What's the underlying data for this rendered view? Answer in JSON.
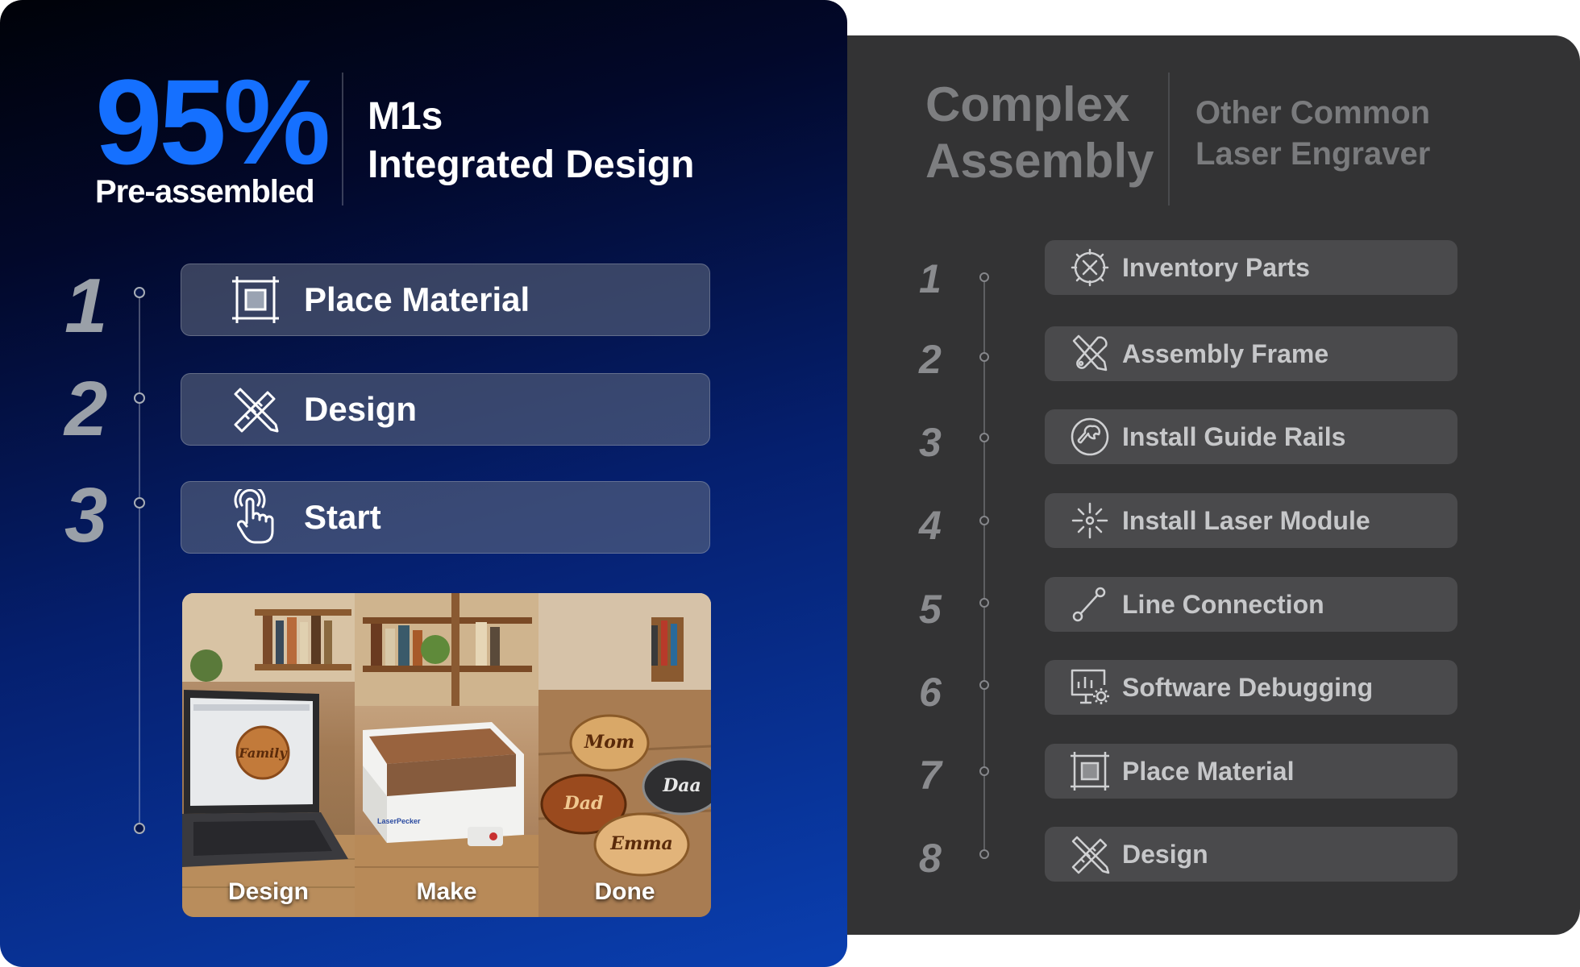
{
  "left": {
    "stat": "95%",
    "stat_sub": "Pre-assembled",
    "product_line1": "M1s",
    "product_line2": "Integrated Design",
    "steps": [
      {
        "num": "1",
        "label": "Place Material",
        "icon": "frame-icon"
      },
      {
        "num": "2",
        "label": "Design",
        "icon": "ruler-pencil-icon"
      },
      {
        "num": "3",
        "label": "Start",
        "icon": "tap-hand-icon"
      }
    ],
    "photos": [
      {
        "caption": "Design",
        "engraving": "Family"
      },
      {
        "caption": "Make",
        "brand": "LaserPecker"
      },
      {
        "caption": "Done",
        "engravings": [
          "Mom",
          "Dad",
          "Emma",
          "Daa"
        ]
      }
    ],
    "colors": {
      "accent": "#1570ff"
    }
  },
  "right": {
    "title_line1": "Complex",
    "title_line2": "Assembly",
    "sub_line1": "Other Common",
    "sub_line2": "Laser Engraver",
    "steps": [
      {
        "num": "1",
        "label": "Inventory Parts",
        "icon": "gear-tools-icon"
      },
      {
        "num": "2",
        "label": "Assembly Frame",
        "icon": "wrench-screwdriver-icon"
      },
      {
        "num": "3",
        "label": "Install Guide Rails",
        "icon": "wrench-circle-icon"
      },
      {
        "num": "4",
        "label": "Install Laser Module",
        "icon": "laser-burst-icon"
      },
      {
        "num": "5",
        "label": "Line Connection",
        "icon": "line-node-icon"
      },
      {
        "num": "6",
        "label": "Software Debugging",
        "icon": "monitor-gear-icon"
      },
      {
        "num": "7",
        "label": "Place Material",
        "icon": "frame-icon"
      },
      {
        "num": "8",
        "label": "Design",
        "icon": "ruler-pencil-icon"
      }
    ]
  }
}
